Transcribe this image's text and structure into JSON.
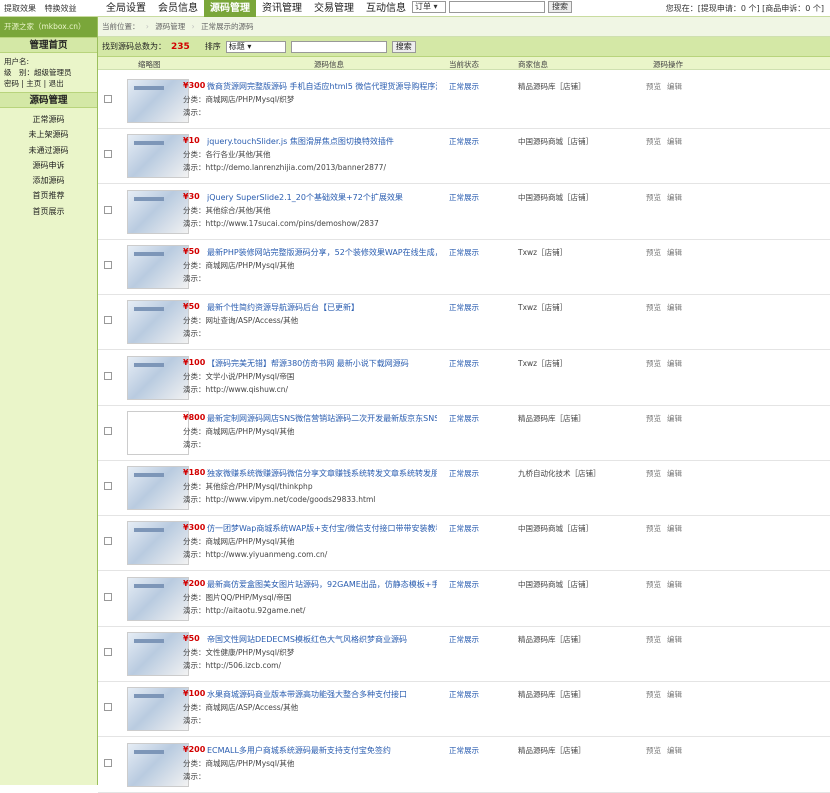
{
  "top": {
    "links": [
      "提取效果",
      "特换效益"
    ],
    "nav_tabs": [
      "全局设置",
      "会员信息",
      "源码管理",
      "资讯管理",
      "交易管理",
      "互动信息"
    ],
    "order_select": "订单 ▾",
    "search_button": "搜索",
    "right_text": "您现在：[提现申请：0 个] [商品申诉：0 个]"
  },
  "sidebar": {
    "site_name": "开源之家（mkbox.cn）",
    "home_title": "管理首页",
    "user_label": "用户名:",
    "role_line": "级　别：超级管理员",
    "user_links": "密码 | 主页 | 退出",
    "menu_title": "源码管理",
    "menu_items": [
      "正常源码",
      "未上架源码",
      "未通过源码",
      "源码申诉",
      "添加源码",
      "首页推荐",
      "首页展示"
    ]
  },
  "breadcrumb": {
    "prefix": "当前位置：",
    "item1": "源码管理",
    "item2": "正常展示的源码"
  },
  "filter": {
    "count_label": "找到源码总数为：",
    "count_value": "235",
    "sort_label": "排序",
    "sort_value": "标题 ▾",
    "search_button": "搜索"
  },
  "table": {
    "headers": [
      "缩略图",
      "源码信息",
      "当前状态",
      "商家信息",
      "源码操作"
    ],
    "rows": [
      {
        "price": "¥300",
        "title": "微商货源网完整版源码 手机自适应html5 微信代理货源导购程序源",
        "category": "分类：商城网店/PHP/Mysql/织梦",
        "demo": "演示：",
        "status": "正常展示",
        "shop": "精品源码库［店铺］",
        "preview": "预览",
        "edit": "编辑"
      },
      {
        "price": "¥10",
        "title": "jquery.touchSlider.js 焦图滑屏焦点图切换特效插件",
        "category": "分类：各行各业/其他/其他",
        "demo": "演示：http://demo.lanrenzhijia.com/2013/banner2877/",
        "status": "正常展示",
        "shop": "中国源码商城［店铺］",
        "preview": "预览",
        "edit": "编辑"
      },
      {
        "price": "¥30",
        "title": "jQuery SuperSlide2.1_20个基础效果+72个扩展效果",
        "category": "分类：其他综合/其他/其他",
        "demo": "演示：http://www.17sucai.com/pins/demoshow/2837",
        "status": "正常展示",
        "shop": "中国源码商城［店铺］",
        "preview": "预览",
        "edit": "编辑"
      },
      {
        "price": "¥50",
        "title": "最新PHP装修网站完整版源码分享，52个装修效果WAP在线生成，无须",
        "category": "分类：商城网店/PHP/Mysql/其他",
        "demo": "演示：",
        "status": "正常展示",
        "shop": "Txwz［店铺］",
        "preview": "预览",
        "edit": "编辑"
      },
      {
        "price": "¥50",
        "title": "最新个性简约资源导航源码后台【已更新】",
        "category": "分类：网址查询/ASP/Access/其他",
        "demo": "演示：",
        "status": "正常展示",
        "shop": "Txwz［店铺］",
        "preview": "预览",
        "edit": "编辑"
      },
      {
        "price": "¥100",
        "title": "【源码完美无错】帮源380仿奇书网 最新小说下载网源码",
        "category": "分类：文学小说/PHP/Mysql/帝国",
        "demo": "演示：http://www.qishuw.cn/",
        "status": "正常展示",
        "shop": "Txwz［店铺］",
        "preview": "预览",
        "edit": "编辑"
      },
      {
        "price": "¥800",
        "title": "最新定制网源码网店SNS微信营销站源码二次开发最新版京东SNS",
        "category": "分类：商城网店/PHP/Mysql/其他",
        "demo": "演示：",
        "status": "正常展示",
        "shop": "精品源码库［店铺］",
        "preview": "预览",
        "edit": "编辑"
      },
      {
        "price": "¥180",
        "title": "独家微赚系统微赚源码微信分享文章赚钱系统转发文章系统转发朋友",
        "category": "分类：其他综合/PHP/Mysql/thinkphp",
        "demo": "演示：http://www.vipym.net/code/goods29833.html",
        "status": "正常展示",
        "shop": "九桥自动化技术［店铺］",
        "preview": "预览",
        "edit": "编辑"
      },
      {
        "price": "¥300",
        "title": "仿一团梦Wap商城系统WAP版+支付宝/微信支付接口带带安装教程",
        "category": "分类：商城网店/PHP/Mysql/其他",
        "demo": "演示：http://www.yiyuanmeng.com.cn/",
        "status": "正常展示",
        "shop": "中国源码商城［店铺］",
        "preview": "预览",
        "edit": "编辑"
      },
      {
        "price": "¥200",
        "title": "最新高仿爱盒图美女图片站源码，92GAME出品，仿静态模板+手机wap版",
        "category": "分类：图片QQ/PHP/Mysql/帝国",
        "demo": "演示：http://aitaotu.92game.net/",
        "status": "正常展示",
        "shop": "中国源码商城［店铺］",
        "preview": "预览",
        "edit": "编辑"
      },
      {
        "price": "¥50",
        "title": "帝国文性网站DEDECMS模板红色大气风格织梦商业源码",
        "category": "分类：文性健康/PHP/Mysql/织梦",
        "demo": "演示：http://506.izcb.com/",
        "status": "正常展示",
        "shop": "精品源码库［店铺］",
        "preview": "预览",
        "edit": "编辑"
      },
      {
        "price": "¥100",
        "title": "水果商城源码商业版本带源高功能强大整合多种支付接口",
        "category": "分类：商城网店/ASP/Access/其他",
        "demo": "演示：",
        "status": "正常展示",
        "shop": "精品源码库［店铺］",
        "preview": "预览",
        "edit": "编辑"
      },
      {
        "price": "¥200",
        "title": "ECMALL多用户商城系统源码最新支持支付宝免签约",
        "category": "分类：商城网店/PHP/Mysql/其他",
        "demo": "演示：",
        "status": "正常展示",
        "shop": "精品源码库［店铺］",
        "preview": "预览",
        "edit": "编辑"
      }
    ]
  }
}
